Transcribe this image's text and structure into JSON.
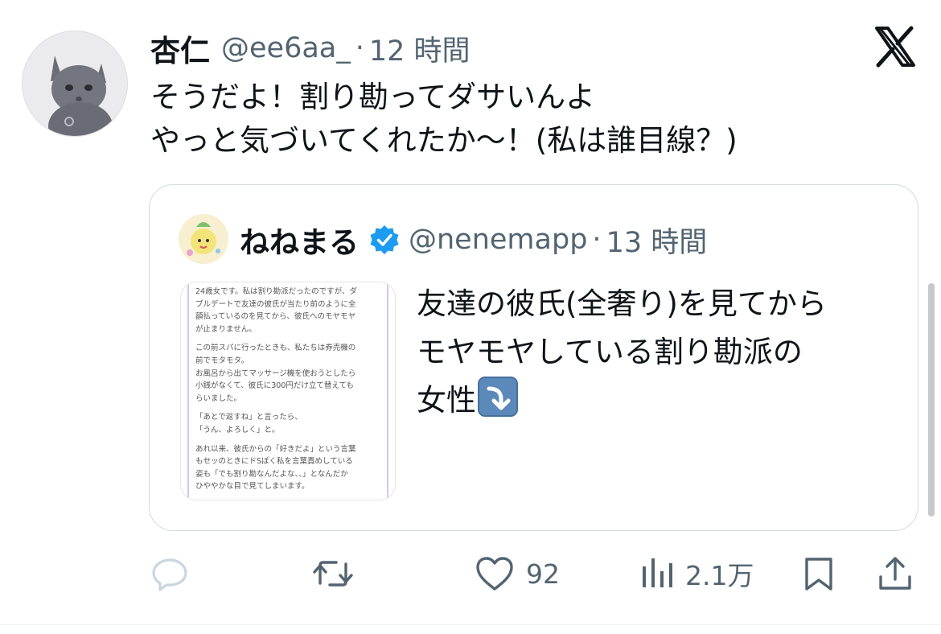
{
  "tweet": {
    "display_name": "杏仁",
    "handle": "@ee6aa_",
    "separator": "·",
    "time": "12 時間",
    "text_lines": [
      "そうだよ！割り勘ってダサいんよ",
      "やっと気づいてくれたか〜！(私は誰目線？)"
    ]
  },
  "quote": {
    "display_name": "ねねまる",
    "handle": "@nenemapp",
    "separator": "·",
    "time": "13 時間",
    "text_lines": [
      "友達の彼氏(全奢り)を見てから",
      "モヤモヤしている割り勘派の",
      "女性"
    ],
    "trailing_emoji": "arrow-down-right-emoji",
    "image_text": [
      "24歳女です。私は割り勘派だったのですが、ダ",
      "ブルデートで友達の彼氏が当たり前のように全",
      "額払っているのを見てから、彼氏へのモヤモヤ",
      "が止まりません。",
      "",
      "この前スパに行ったときも、私たちは券売機の",
      "前でモタモタ。",
      "お風呂から出てマッサージ機を使おうとしたら",
      "小銭がなくて、彼氏に300円だけ立て替えても",
      "らいました。",
      "",
      "「あとで返すね」と言ったら、",
      "「うん、よろしく」と。",
      "",
      "あれ以来、彼氏からの「好きだよ」という言葉",
      "もセッのときにドSぽく私を言葉責めしている",
      "姿も「でも割り勘なんだよな、、」となんだか",
      "ひややかな目で見てしまいます。"
    ]
  },
  "actions": {
    "reply_count": "",
    "retweet_count": "",
    "like_count": "92",
    "views_count": "2.1万"
  },
  "colors": {
    "text": "#0f1419",
    "secondary": "#536471",
    "verified_blue": "#1d9bf0",
    "border": "#d3dbe0"
  },
  "icons": [
    "x-logo-icon",
    "verified-badge-icon",
    "reply-icon",
    "retweet-icon",
    "like-icon",
    "views-icon",
    "bookmark-icon",
    "share-icon"
  ]
}
